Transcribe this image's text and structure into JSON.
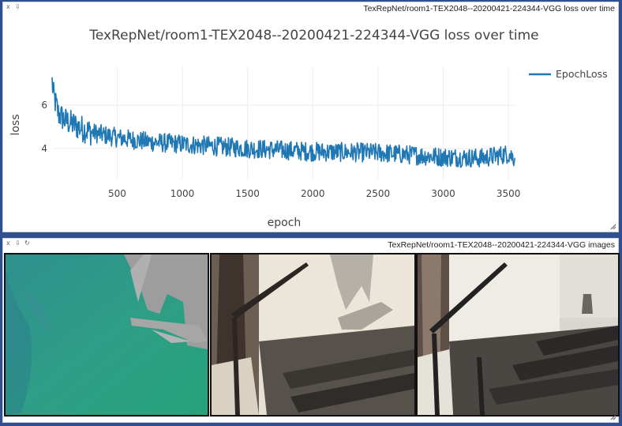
{
  "plot_pane": {
    "window_title": "TexRepNet/room1-TEX2048--20200421-224344-VGG loss over time",
    "close_glyph": "x",
    "download_glyph": "⇩"
  },
  "image_pane": {
    "window_title": "TexRepNet/room1-TEX2048--20200421-224344-VGG images",
    "close_glyph": "x",
    "download_glyph": "⇩",
    "reload_glyph": "↻",
    "images": [
      "uv-texture-coordinate-render",
      "neural-texture-render",
      "ground-truth-photo"
    ]
  },
  "chart_data": {
    "type": "line",
    "title": "TexRepNet/room1-TEX2048--20200421-224344-VGG loss over time",
    "xlabel": "epoch",
    "ylabel": "loss",
    "xlim": [
      1,
      3560
    ],
    "ylim": [
      2.6,
      7.8
    ],
    "xticks": [
      500,
      1000,
      1500,
      2000,
      2500,
      3000,
      3500
    ],
    "yticks": [
      4,
      6
    ],
    "grid": true,
    "legend_position": "top-right",
    "series": [
      {
        "name": "EpochLoss",
        "color": "#1f77b4",
        "trend_x": [
          1,
          10,
          50,
          100,
          200,
          300,
          500,
          750,
          1000,
          1500,
          2000,
          2500,
          3000,
          3300,
          3500,
          3550
        ],
        "trend_y": [
          7.1,
          6.5,
          5.6,
          5.3,
          5.0,
          4.75,
          4.5,
          4.3,
          4.2,
          4.0,
          3.85,
          3.8,
          3.6,
          3.55,
          3.75,
          3.55
        ],
        "noise_amplitude": 0.45,
        "n_points": 3550
      }
    ]
  }
}
